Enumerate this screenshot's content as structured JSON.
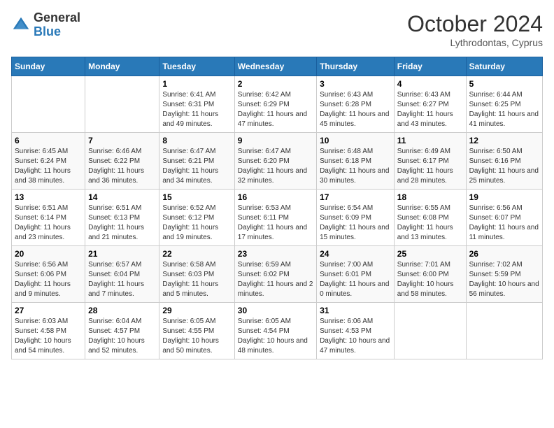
{
  "logo": {
    "general": "General",
    "blue": "Blue"
  },
  "header": {
    "month": "October 2024",
    "location": "Lythrodontas, Cyprus"
  },
  "weekdays": [
    "Sunday",
    "Monday",
    "Tuesday",
    "Wednesday",
    "Thursday",
    "Friday",
    "Saturday"
  ],
  "weeks": [
    [
      {
        "day": "",
        "sunrise": "",
        "sunset": "",
        "daylight": ""
      },
      {
        "day": "",
        "sunrise": "",
        "sunset": "",
        "daylight": ""
      },
      {
        "day": "1",
        "sunrise": "Sunrise: 6:41 AM",
        "sunset": "Sunset: 6:31 PM",
        "daylight": "Daylight: 11 hours and 49 minutes."
      },
      {
        "day": "2",
        "sunrise": "Sunrise: 6:42 AM",
        "sunset": "Sunset: 6:29 PM",
        "daylight": "Daylight: 11 hours and 47 minutes."
      },
      {
        "day": "3",
        "sunrise": "Sunrise: 6:43 AM",
        "sunset": "Sunset: 6:28 PM",
        "daylight": "Daylight: 11 hours and 45 minutes."
      },
      {
        "day": "4",
        "sunrise": "Sunrise: 6:43 AM",
        "sunset": "Sunset: 6:27 PM",
        "daylight": "Daylight: 11 hours and 43 minutes."
      },
      {
        "day": "5",
        "sunrise": "Sunrise: 6:44 AM",
        "sunset": "Sunset: 6:25 PM",
        "daylight": "Daylight: 11 hours and 41 minutes."
      }
    ],
    [
      {
        "day": "6",
        "sunrise": "Sunrise: 6:45 AM",
        "sunset": "Sunset: 6:24 PM",
        "daylight": "Daylight: 11 hours and 38 minutes."
      },
      {
        "day": "7",
        "sunrise": "Sunrise: 6:46 AM",
        "sunset": "Sunset: 6:22 PM",
        "daylight": "Daylight: 11 hours and 36 minutes."
      },
      {
        "day": "8",
        "sunrise": "Sunrise: 6:47 AM",
        "sunset": "Sunset: 6:21 PM",
        "daylight": "Daylight: 11 hours and 34 minutes."
      },
      {
        "day": "9",
        "sunrise": "Sunrise: 6:47 AM",
        "sunset": "Sunset: 6:20 PM",
        "daylight": "Daylight: 11 hours and 32 minutes."
      },
      {
        "day": "10",
        "sunrise": "Sunrise: 6:48 AM",
        "sunset": "Sunset: 6:18 PM",
        "daylight": "Daylight: 11 hours and 30 minutes."
      },
      {
        "day": "11",
        "sunrise": "Sunrise: 6:49 AM",
        "sunset": "Sunset: 6:17 PM",
        "daylight": "Daylight: 11 hours and 28 minutes."
      },
      {
        "day": "12",
        "sunrise": "Sunrise: 6:50 AM",
        "sunset": "Sunset: 6:16 PM",
        "daylight": "Daylight: 11 hours and 25 minutes."
      }
    ],
    [
      {
        "day": "13",
        "sunrise": "Sunrise: 6:51 AM",
        "sunset": "Sunset: 6:14 PM",
        "daylight": "Daylight: 11 hours and 23 minutes."
      },
      {
        "day": "14",
        "sunrise": "Sunrise: 6:51 AM",
        "sunset": "Sunset: 6:13 PM",
        "daylight": "Daylight: 11 hours and 21 minutes."
      },
      {
        "day": "15",
        "sunrise": "Sunrise: 6:52 AM",
        "sunset": "Sunset: 6:12 PM",
        "daylight": "Daylight: 11 hours and 19 minutes."
      },
      {
        "day": "16",
        "sunrise": "Sunrise: 6:53 AM",
        "sunset": "Sunset: 6:11 PM",
        "daylight": "Daylight: 11 hours and 17 minutes."
      },
      {
        "day": "17",
        "sunrise": "Sunrise: 6:54 AM",
        "sunset": "Sunset: 6:09 PM",
        "daylight": "Daylight: 11 hours and 15 minutes."
      },
      {
        "day": "18",
        "sunrise": "Sunrise: 6:55 AM",
        "sunset": "Sunset: 6:08 PM",
        "daylight": "Daylight: 11 hours and 13 minutes."
      },
      {
        "day": "19",
        "sunrise": "Sunrise: 6:56 AM",
        "sunset": "Sunset: 6:07 PM",
        "daylight": "Daylight: 11 hours and 11 minutes."
      }
    ],
    [
      {
        "day": "20",
        "sunrise": "Sunrise: 6:56 AM",
        "sunset": "Sunset: 6:06 PM",
        "daylight": "Daylight: 11 hours and 9 minutes."
      },
      {
        "day": "21",
        "sunrise": "Sunrise: 6:57 AM",
        "sunset": "Sunset: 6:04 PM",
        "daylight": "Daylight: 11 hours and 7 minutes."
      },
      {
        "day": "22",
        "sunrise": "Sunrise: 6:58 AM",
        "sunset": "Sunset: 6:03 PM",
        "daylight": "Daylight: 11 hours and 5 minutes."
      },
      {
        "day": "23",
        "sunrise": "Sunrise: 6:59 AM",
        "sunset": "Sunset: 6:02 PM",
        "daylight": "Daylight: 11 hours and 2 minutes."
      },
      {
        "day": "24",
        "sunrise": "Sunrise: 7:00 AM",
        "sunset": "Sunset: 6:01 PM",
        "daylight": "Daylight: 11 hours and 0 minutes."
      },
      {
        "day": "25",
        "sunrise": "Sunrise: 7:01 AM",
        "sunset": "Sunset: 6:00 PM",
        "daylight": "Daylight: 10 hours and 58 minutes."
      },
      {
        "day": "26",
        "sunrise": "Sunrise: 7:02 AM",
        "sunset": "Sunset: 5:59 PM",
        "daylight": "Daylight: 10 hours and 56 minutes."
      }
    ],
    [
      {
        "day": "27",
        "sunrise": "Sunrise: 6:03 AM",
        "sunset": "Sunset: 4:58 PM",
        "daylight": "Daylight: 10 hours and 54 minutes."
      },
      {
        "day": "28",
        "sunrise": "Sunrise: 6:04 AM",
        "sunset": "Sunset: 4:57 PM",
        "daylight": "Daylight: 10 hours and 52 minutes."
      },
      {
        "day": "29",
        "sunrise": "Sunrise: 6:05 AM",
        "sunset": "Sunset: 4:55 PM",
        "daylight": "Daylight: 10 hours and 50 minutes."
      },
      {
        "day": "30",
        "sunrise": "Sunrise: 6:05 AM",
        "sunset": "Sunset: 4:54 PM",
        "daylight": "Daylight: 10 hours and 48 minutes."
      },
      {
        "day": "31",
        "sunrise": "Sunrise: 6:06 AM",
        "sunset": "Sunset: 4:53 PM",
        "daylight": "Daylight: 10 hours and 47 minutes."
      },
      {
        "day": "",
        "sunrise": "",
        "sunset": "",
        "daylight": ""
      },
      {
        "day": "",
        "sunrise": "",
        "sunset": "",
        "daylight": ""
      }
    ]
  ]
}
